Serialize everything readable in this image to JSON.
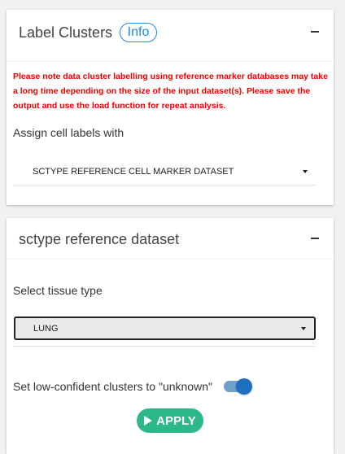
{
  "colors": {
    "accent": "#1e88e5",
    "warning": "#ee0000",
    "apply": "#2db88b",
    "toggle_on": "#1f6fbf"
  },
  "label_clusters_panel": {
    "title": "Label Clusters",
    "info_label": "Info",
    "collapse_icon": "minus-icon",
    "warning_text": "Please note data cluster labelling using reference marker databases may take a long time depending on the size of the input dataset(s). Please save the output and use the load function for repeat analysis.",
    "assign_label": "Assign cell labels with",
    "assign_selected": "SCTYPE REFERENCE CELL MARKER DATASET"
  },
  "sctype_panel": {
    "title": "sctype reference dataset",
    "collapse_icon": "minus-icon",
    "tissue_label": "Select tissue type",
    "tissue_selected": "LUNG",
    "toggle_label": "Set low-confident clusters to \"unknown\"",
    "toggle_on": true,
    "apply_label": "APPLY",
    "apply_icon": "play-icon"
  }
}
